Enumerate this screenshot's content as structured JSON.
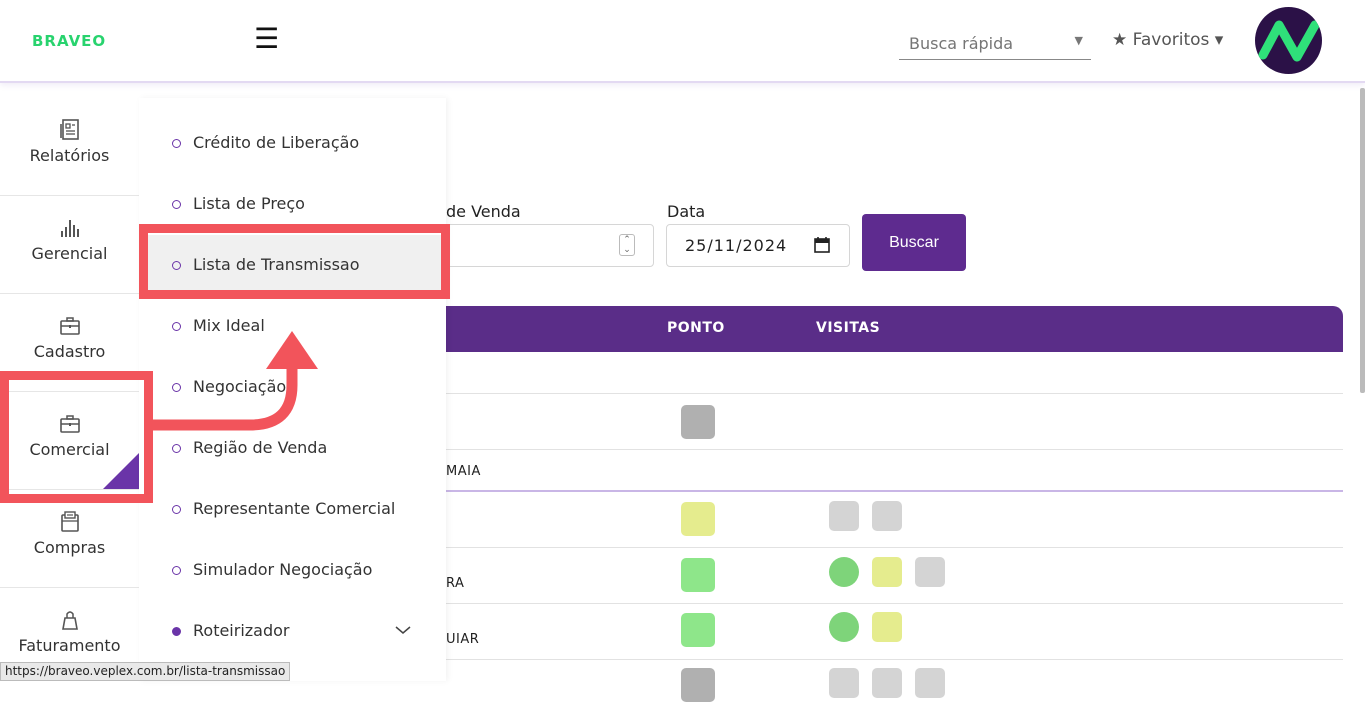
{
  "header": {
    "logo": "BRAVEO",
    "menu_icon": "hamburger-icon",
    "search_placeholder": "Busca rápida",
    "favorites_label": "★ Favoritos ▾"
  },
  "sidebar": {
    "items": [
      {
        "label": "Relatórios",
        "icon": "newspaper-icon"
      },
      {
        "label": "Gerencial",
        "icon": "bar-chart-icon"
      },
      {
        "label": "Cadastro",
        "icon": "briefcase-icon"
      },
      {
        "label": "Comercial",
        "icon": "briefcase-icon"
      },
      {
        "label": "Compras",
        "icon": "document-icon"
      },
      {
        "label": "Faturamento",
        "icon": "bag-icon"
      }
    ]
  },
  "submenu": {
    "items": [
      {
        "label": "Crédito de Liberação"
      },
      {
        "label": "Lista de Preço"
      },
      {
        "label": "Lista de Transmissao"
      },
      {
        "label": "Mix Ideal"
      },
      {
        "label": "Negociação"
      },
      {
        "label": "Região de Venda"
      },
      {
        "label": "Representante Comercial"
      },
      {
        "label": "Simulador Negociação"
      },
      {
        "label": "Roteirizador"
      }
    ]
  },
  "filters": {
    "region_label": "de Venda",
    "date_label": "Data",
    "date_value": "25/11/2024",
    "search_button": "Buscar"
  },
  "table": {
    "headers": [
      "PONTO",
      "VISITAS"
    ],
    "row_texts": [
      "MAIA",
      "RA",
      "UIAR"
    ]
  },
  "colors": {
    "primary": "#5e2b8f",
    "accent_green": "#28d36e",
    "highlight_red": "#f2545b",
    "status_gray": "#b0b0b0",
    "status_yellow": "#e5ec8e",
    "status_green": "#8ee68a",
    "status_lightgray": "#d4d4d4"
  },
  "status_bar": {
    "url": "https://braveo.veplex.com.br/lista-transmissao"
  }
}
